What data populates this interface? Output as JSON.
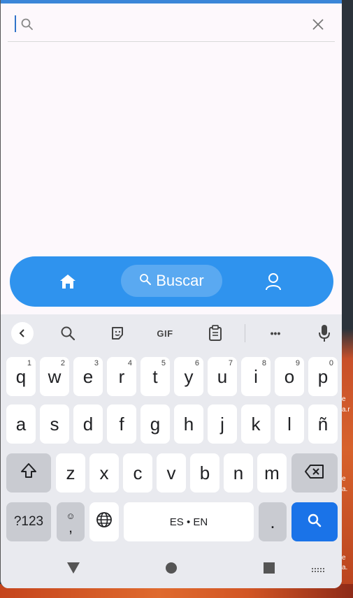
{
  "search": {
    "placeholder": "",
    "value": ""
  },
  "nav": {
    "items": [
      {
        "id": "home",
        "icon": "home-icon",
        "active": false
      },
      {
        "id": "search",
        "icon": "search-icon",
        "label": "Buscar",
        "active": true
      },
      {
        "id": "profile",
        "icon": "user-icon",
        "active": false
      }
    ],
    "search_label": "Buscar",
    "color": "#2f93ee",
    "active_color": "#5aa9f1"
  },
  "keyboard": {
    "toolbar": {
      "icons": [
        "chevron-left-icon",
        "search-icon",
        "sticker-icon",
        "gif-icon",
        "clipboard-icon",
        "more-icon",
        "microphone-icon"
      ],
      "gif_label": "GIF",
      "more_label": "•••"
    },
    "row1": [
      {
        "key": "q",
        "hint": "1"
      },
      {
        "key": "w",
        "hint": "2"
      },
      {
        "key": "e",
        "hint": "3"
      },
      {
        "key": "r",
        "hint": "4"
      },
      {
        "key": "t",
        "hint": "5"
      },
      {
        "key": "y",
        "hint": "6"
      },
      {
        "key": "u",
        "hint": "7"
      },
      {
        "key": "i",
        "hint": "8"
      },
      {
        "key": "o",
        "hint": "9"
      },
      {
        "key": "p",
        "hint": "0"
      }
    ],
    "row2": [
      "a",
      "s",
      "d",
      "f",
      "g",
      "h",
      "j",
      "k",
      "l",
      "ñ"
    ],
    "row3": [
      "z",
      "x",
      "c",
      "v",
      "b",
      "n",
      "m"
    ],
    "row4": {
      "symbols": "?123",
      "emoji_comma_top": "☺",
      "emoji_comma_bottom": ",",
      "space": "ES • EN",
      "period": "."
    },
    "accent_color": "#1a73e8"
  },
  "desktop_fragments": [
    "e",
    "a.r",
    "e",
    "a.",
    "e",
    "a."
  ]
}
